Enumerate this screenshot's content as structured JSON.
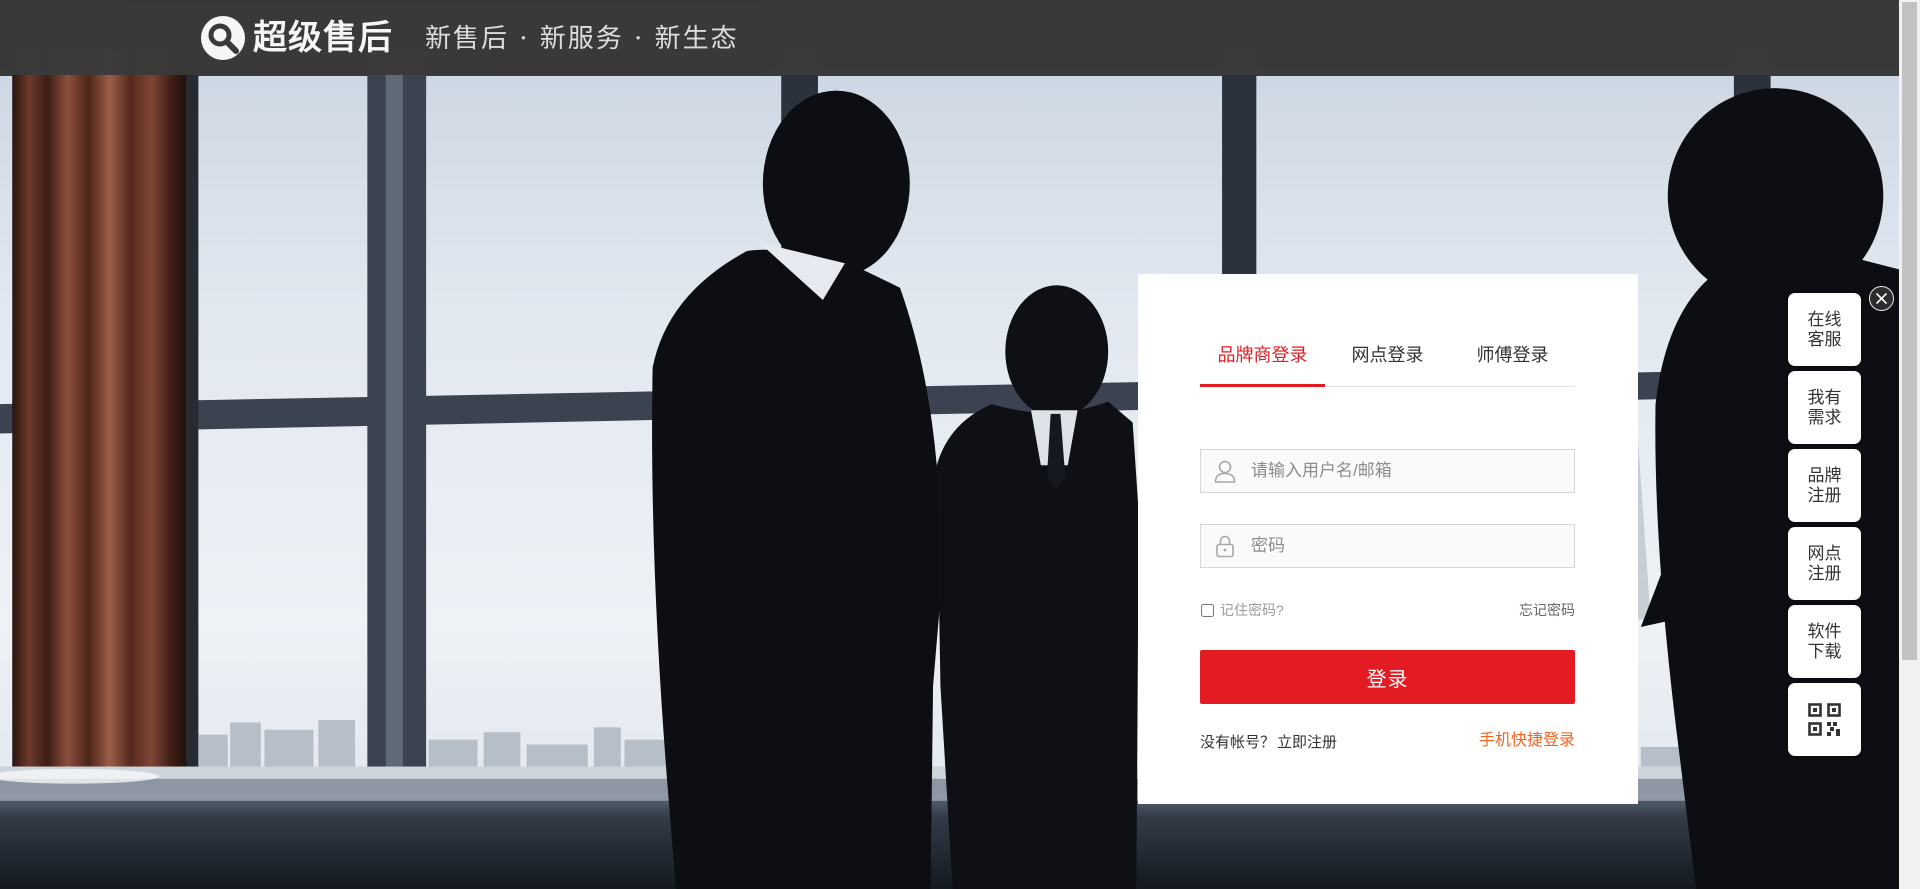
{
  "colors": {
    "accent": "#e31b23",
    "sms_link": "#f26522",
    "header_bg": "#3a3a3a"
  },
  "header": {
    "logo_icon": "wrench-search-icon",
    "logo_text": "超级售后",
    "tagline": "新售后 · 新服务 · 新生态"
  },
  "login": {
    "tabs": [
      {
        "label": "品牌商登录",
        "active": true
      },
      {
        "label": "网点登录",
        "active": false
      },
      {
        "label": "师傅登录",
        "active": false
      }
    ],
    "username": {
      "icon": "user-icon",
      "placeholder": "请输入用户名/邮箱",
      "value": ""
    },
    "password": {
      "icon": "lock-icon",
      "placeholder": "密码",
      "value": ""
    },
    "remember": {
      "label": "记住密码?",
      "checked": false
    },
    "forgot_label": "忘记密码",
    "submit_label": "登录",
    "no_account_label": "没有帐号？",
    "register_label": "立即注册",
    "sms_login_label": "手机快捷登录"
  },
  "side_toolbar": {
    "close_icon": "close-icon",
    "items": [
      {
        "lines": [
          "在线",
          "客服"
        ]
      },
      {
        "lines": [
          "我有",
          "需求"
        ]
      },
      {
        "lines": [
          "品牌",
          "注册"
        ]
      },
      {
        "lines": [
          "网点",
          "注册"
        ]
      },
      {
        "lines": [
          "软件",
          "下载"
        ]
      },
      {
        "icon": "qr-code-icon"
      }
    ]
  }
}
